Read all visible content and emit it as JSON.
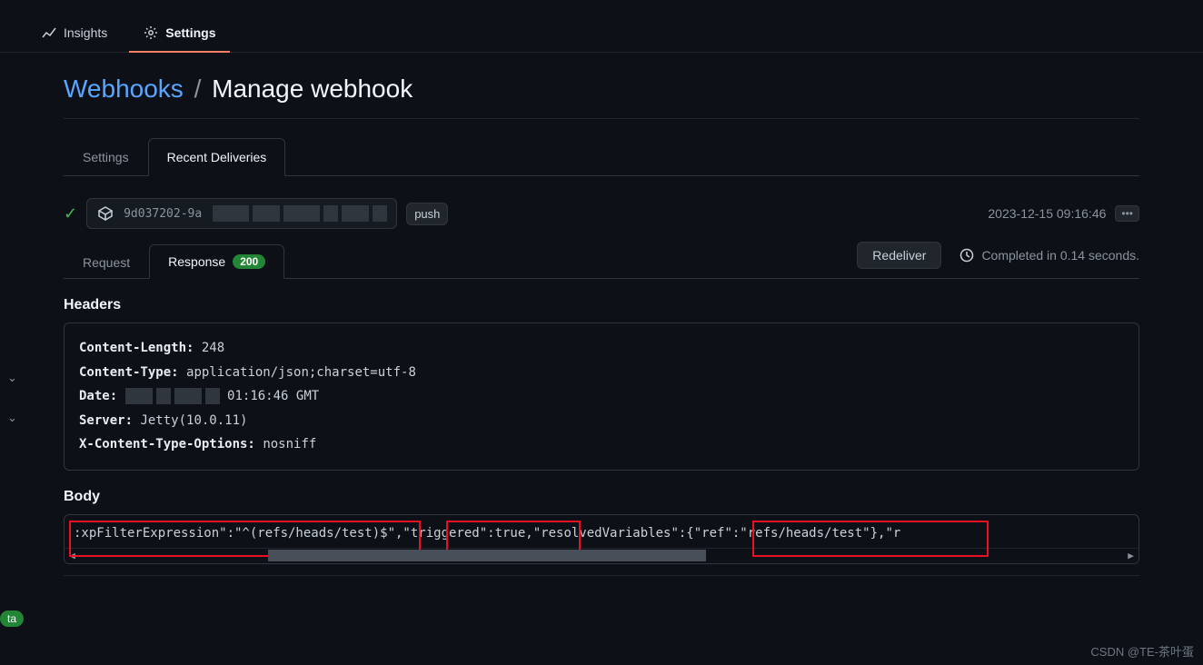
{
  "topNav": {
    "insights": "Insights",
    "settings": "Settings"
  },
  "breadcrumb": {
    "link": "Webhooks",
    "sep": "/",
    "current": "Manage webhook"
  },
  "tabs": {
    "settings": "Settings",
    "recent": "Recent Deliveries"
  },
  "delivery": {
    "id": "9d037202-9a",
    "event": "push",
    "timestamp": "2023-12-15 09:16:46",
    "ellipsis": "•••"
  },
  "subTabs": {
    "request": "Request",
    "response": "Response",
    "status": "200",
    "redeliver": "Redeliver",
    "completed": "Completed in 0.14 seconds."
  },
  "headers": {
    "title": "Headers",
    "contentLengthKey": "Content-Length:",
    "contentLengthVal": "248",
    "contentTypeKey": "Content-Type:",
    "contentTypeVal": "application/json;charset=utf-8",
    "dateKey": "Date:",
    "dateVal": "01:16:46 GMT",
    "serverKey": "Server:",
    "serverVal": "Jetty(10.0.11)",
    "xctoKey": "X-Content-Type-Options:",
    "xctoVal": "nosniff"
  },
  "body": {
    "title": "Body",
    "text": ":xpFilterExpression\":\"^(refs/heads/test)$\",\"triggered\":true,\"resolvedVariables\":{\"ref\":\"refs/heads/test\"},\"r"
  },
  "beta": "ta",
  "watermark": "CSDN @TE-茶叶蛋"
}
